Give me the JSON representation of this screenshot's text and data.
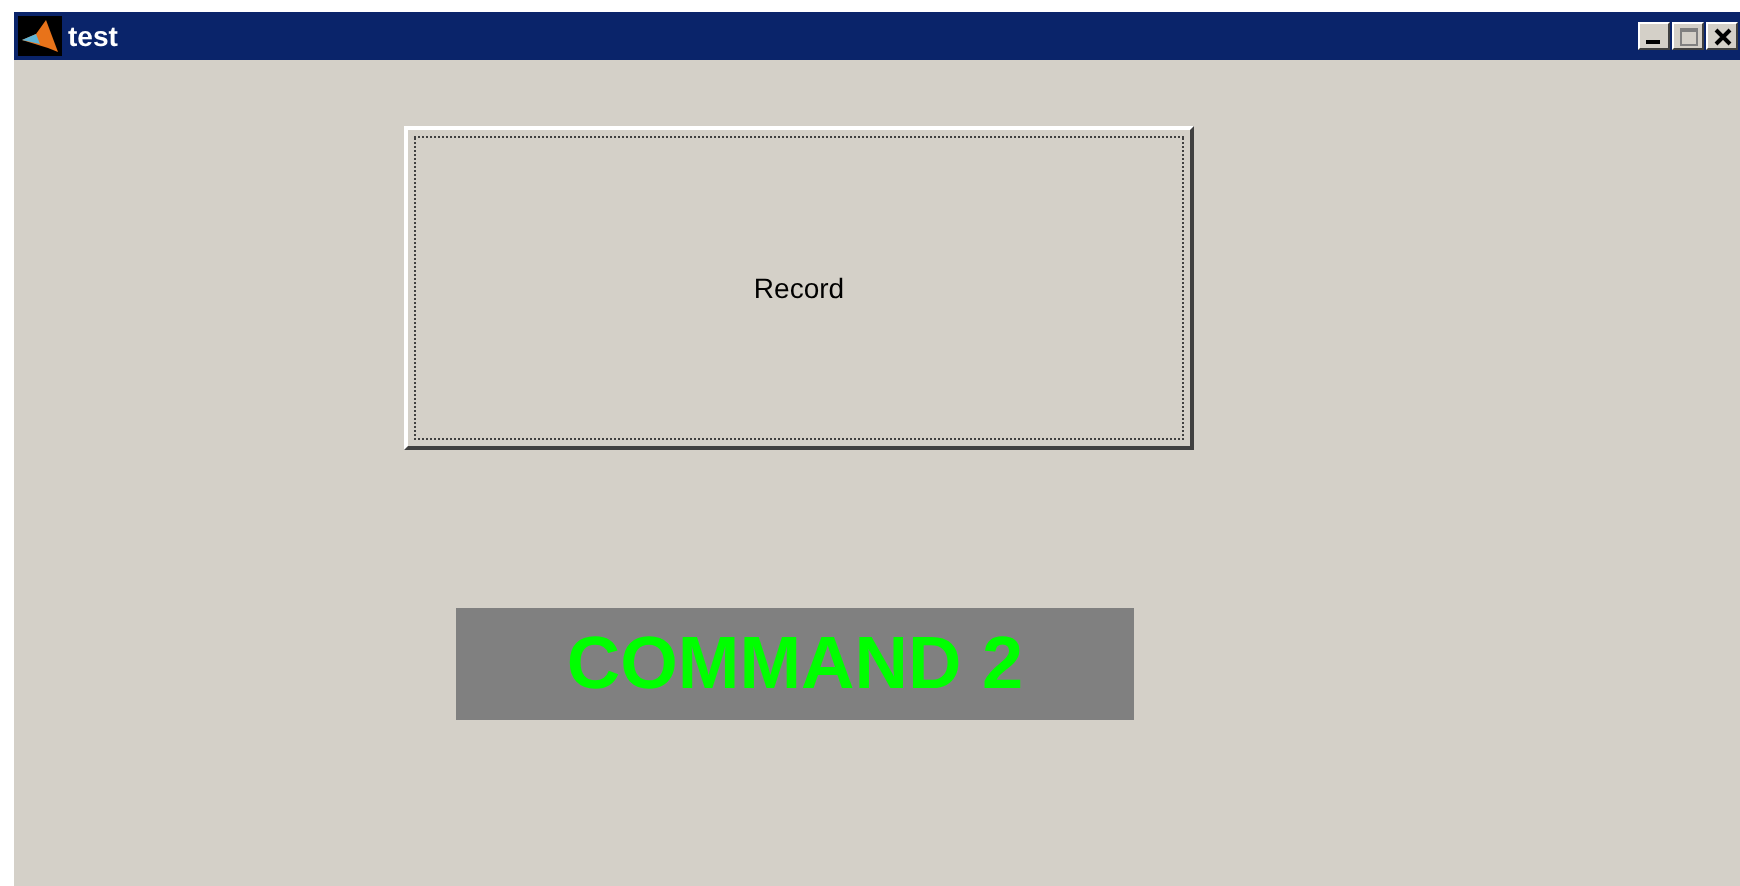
{
  "window": {
    "title": "test"
  },
  "record_button": {
    "label": "Record",
    "focused": true
  },
  "command_label": {
    "text": "COMMAND 2"
  }
}
